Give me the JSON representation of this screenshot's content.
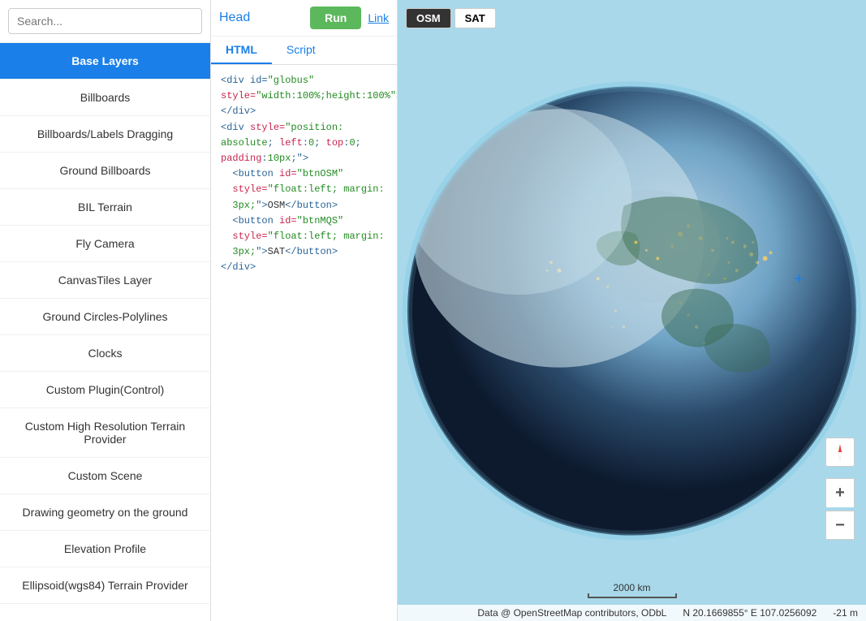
{
  "search": {
    "placeholder": "Search..."
  },
  "sidebar": {
    "items": [
      {
        "label": "Base Layers",
        "active": true
      },
      {
        "label": "Billboards",
        "active": false
      },
      {
        "label": "Billboards/Labels Dragging",
        "active": false
      },
      {
        "label": "Ground Billboards",
        "active": false
      },
      {
        "label": "BIL Terrain",
        "active": false
      },
      {
        "label": "Fly Camera",
        "active": false
      },
      {
        "label": "CanvasTiles Layer",
        "active": false
      },
      {
        "label": "Ground Circles-Polylines",
        "active": false
      },
      {
        "label": "Clocks",
        "active": false
      },
      {
        "label": "Custom Plugin(Control)",
        "active": false
      },
      {
        "label": "Custom High Resolution Terrain Provider",
        "active": false
      },
      {
        "label": "Custom Scene",
        "active": false
      },
      {
        "label": "Drawing geometry on the ground",
        "active": false
      },
      {
        "label": "Elevation Profile",
        "active": false
      },
      {
        "label": "Ellipsoid(wgs84) Terrain Provider",
        "active": false
      }
    ]
  },
  "middle": {
    "head_label": "Head",
    "run_label": "Run",
    "link_label": "Link",
    "tabs": [
      {
        "label": "HTML",
        "active": true
      },
      {
        "label": "Script",
        "active": false
      }
    ],
    "code_lines": [
      {
        "text": "<div id=\"globus\"",
        "type": "tag"
      },
      {
        "text": "style=\"width:100%;height:100%\">",
        "type": "attr"
      },
      {
        "text": "></div>",
        "type": "tag"
      },
      {
        "text": "<div style=\"position:",
        "type": "tag"
      },
      {
        "text": "absolute; left:0; top:0;",
        "type": "attr"
      },
      {
        "text": "padding:10px;\">",
        "type": "attr"
      },
      {
        "text": "  <button id=\"btnOSM\"",
        "type": "tag"
      },
      {
        "text": "style=\"float:left; margin:",
        "type": "attr"
      },
      {
        "text": "3px;\">OSM</button>",
        "type": "val"
      },
      {
        "text": "  <button id=\"btnMQS\"",
        "type": "tag"
      },
      {
        "text": "style=\"float:left; margin:",
        "type": "attr"
      },
      {
        "text": "3px;\">SAT</button>",
        "type": "val"
      },
      {
        "text": "</div>",
        "type": "tag"
      }
    ]
  },
  "map": {
    "osm_label": "OSM",
    "sat_label": "SAT",
    "scale": "2000 km",
    "coords": "N 20.1669855°  E 107.0256092",
    "elevation": "-21 m",
    "attribution": "Data @ OpenStreetMap contributors, ODbL",
    "controls": {
      "zoom_in": "+",
      "zoom_out": "−"
    }
  }
}
